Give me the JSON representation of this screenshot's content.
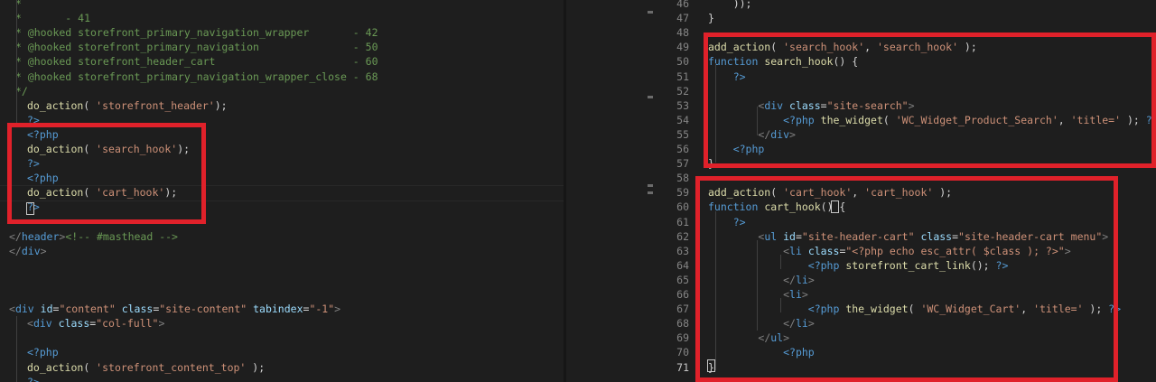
{
  "left_editor": {
    "lines": [
      [
        {
          "t": " *",
          "c": "c-comment"
        }
      ],
      [
        {
          "t": " *       - 41",
          "c": "c-comment"
        }
      ],
      [
        {
          "t": " * @hooked storefront_primary_navigation_wrapper       - 42",
          "c": "c-comment"
        }
      ],
      [
        {
          "t": " * @hooked storefront_primary_navigation               - 50",
          "c": "c-comment"
        }
      ],
      [
        {
          "t": " * @hooked storefront_header_cart                      - 60",
          "c": "c-comment"
        }
      ],
      [
        {
          "t": " * @hooked storefront_primary_navigation_wrapper_close - 68",
          "c": "c-comment"
        }
      ],
      [
        {
          "t": " */",
          "c": "c-comment"
        }
      ],
      [
        {
          "t": "do_action",
          "c": "c-func"
        },
        {
          "t": "( ",
          "c": "c-plain"
        },
        {
          "t": "'storefront_header'",
          "c": "c-string"
        },
        {
          "t": ");",
          "c": "c-plain"
        }
      ],
      [
        {
          "t": "?>",
          "c": "c-php"
        }
      ],
      [
        {
          "t": "<?php",
          "c": "c-php"
        }
      ],
      [
        {
          "t": "do_action",
          "c": "c-func"
        },
        {
          "t": "( ",
          "c": "c-plain"
        },
        {
          "t": "'search_hook'",
          "c": "c-string"
        },
        {
          "t": ");",
          "c": "c-plain"
        }
      ],
      [
        {
          "t": "?>",
          "c": "c-php"
        }
      ],
      [
        {
          "t": "<?php",
          "c": "c-php"
        }
      ],
      [
        {
          "t": "do_action",
          "c": "c-func"
        },
        {
          "t": "( ",
          "c": "c-plain"
        },
        {
          "t": "'cart_hook'",
          "c": "c-string"
        },
        {
          "t": ");",
          "c": "c-plain"
        }
      ],
      [
        {
          "t": "?>",
          "c": "c-php"
        }
      ],
      [],
      [
        {
          "t": "</",
          "c": "c-punct"
        },
        {
          "t": "header",
          "c": "c-tag"
        },
        {
          "t": ">",
          "c": "c-punct"
        },
        {
          "t": "<!-- #masthead -->",
          "c": "c-comment"
        }
      ],
      [
        {
          "t": "</",
          "c": "c-punct"
        },
        {
          "t": "div",
          "c": "c-tag"
        },
        {
          "t": ">",
          "c": "c-punct"
        }
      ],
      [],
      [],
      [],
      [
        {
          "t": "<",
          "c": "c-punct"
        },
        {
          "t": "div ",
          "c": "c-tag"
        },
        {
          "t": "id",
          "c": "c-attr"
        },
        {
          "t": "=",
          "c": "c-plain"
        },
        {
          "t": "\"content\" ",
          "c": "c-string"
        },
        {
          "t": "class",
          "c": "c-attr"
        },
        {
          "t": "=",
          "c": "c-plain"
        },
        {
          "t": "\"site-content\" ",
          "c": "c-string"
        },
        {
          "t": "tabindex",
          "c": "c-attr"
        },
        {
          "t": "=",
          "c": "c-plain"
        },
        {
          "t": "\"-1\"",
          "c": "c-string"
        },
        {
          "t": ">",
          "c": "c-punct"
        }
      ],
      [
        {
          "t": "<",
          "c": "c-punct"
        },
        {
          "t": "div ",
          "c": "c-tag"
        },
        {
          "t": "class",
          "c": "c-attr"
        },
        {
          "t": "=",
          "c": "c-plain"
        },
        {
          "t": "\"col-full\"",
          "c": "c-string"
        },
        {
          "t": ">",
          "c": "c-punct"
        }
      ],
      [],
      [
        {
          "t": "<?php",
          "c": "c-php"
        }
      ],
      [
        {
          "t": "do_action",
          "c": "c-func"
        },
        {
          "t": "( ",
          "c": "c-plain"
        },
        {
          "t": "'storefront_content_top'",
          "c": "c-string"
        },
        {
          "t": " );",
          "c": "c-plain"
        }
      ],
      [
        {
          "t": "?>",
          "c": "c-php"
        }
      ]
    ]
  },
  "right_editor": {
    "active_line": "71",
    "lines": [
      {
        "n": "46",
        "toks": [
          {
            "t": "    ));",
            "c": "c-plain"
          }
        ]
      },
      {
        "n": "47",
        "toks": [
          {
            "t": "}",
            "c": "c-plain"
          }
        ]
      },
      {
        "n": "48",
        "toks": []
      },
      {
        "n": "49",
        "toks": [
          {
            "t": "add_action",
            "c": "c-func"
          },
          {
            "t": "( ",
            "c": "c-plain"
          },
          {
            "t": "'search_hook'",
            "c": "c-string"
          },
          {
            "t": ", ",
            "c": "c-plain"
          },
          {
            "t": "'search_hook'",
            "c": "c-string"
          },
          {
            "t": " );",
            "c": "c-plain"
          }
        ]
      },
      {
        "n": "50",
        "toks": [
          {
            "t": "function ",
            "c": "c-keyword"
          },
          {
            "t": "search_hook",
            "c": "c-func"
          },
          {
            "t": "() {",
            "c": "c-plain"
          }
        ]
      },
      {
        "n": "51",
        "toks": [
          {
            "t": "    ",
            "c": "c-plain"
          },
          {
            "t": "?>",
            "c": "c-php"
          }
        ]
      },
      {
        "n": "52",
        "toks": []
      },
      {
        "n": "53",
        "toks": [
          {
            "t": "        ",
            "c": "c-plain"
          },
          {
            "t": "<",
            "c": "c-punct"
          },
          {
            "t": "div ",
            "c": "c-tag"
          },
          {
            "t": "class",
            "c": "c-attr"
          },
          {
            "t": "=",
            "c": "c-plain"
          },
          {
            "t": "\"site-search\"",
            "c": "c-string"
          },
          {
            "t": ">",
            "c": "c-punct"
          }
        ]
      },
      {
        "n": "54",
        "toks": [
          {
            "t": "            ",
            "c": "c-plain"
          },
          {
            "t": "<?php ",
            "c": "c-php"
          },
          {
            "t": "the_widget",
            "c": "c-func"
          },
          {
            "t": "( ",
            "c": "c-plain"
          },
          {
            "t": "'WC_Widget_Product_Search'",
            "c": "c-string"
          },
          {
            "t": ", ",
            "c": "c-plain"
          },
          {
            "t": "'title='",
            "c": "c-string"
          },
          {
            "t": " ); ",
            "c": "c-plain"
          },
          {
            "t": "?>",
            "c": "c-php"
          }
        ]
      },
      {
        "n": "55",
        "toks": [
          {
            "t": "        ",
            "c": "c-plain"
          },
          {
            "t": "</",
            "c": "c-punct"
          },
          {
            "t": "div",
            "c": "c-tag"
          },
          {
            "t": ">",
            "c": "c-punct"
          }
        ]
      },
      {
        "n": "56",
        "toks": [
          {
            "t": "    ",
            "c": "c-plain"
          },
          {
            "t": "<?php",
            "c": "c-php"
          }
        ]
      },
      {
        "n": "57",
        "toks": [
          {
            "t": "}",
            "c": "c-plain"
          }
        ]
      },
      {
        "n": "58",
        "toks": []
      },
      {
        "n": "59",
        "toks": [
          {
            "t": "add_action",
            "c": "c-func"
          },
          {
            "t": "( ",
            "c": "c-plain"
          },
          {
            "t": "'cart_hook'",
            "c": "c-string"
          },
          {
            "t": ", ",
            "c": "c-plain"
          },
          {
            "t": "'cart_hook'",
            "c": "c-string"
          },
          {
            "t": " );",
            "c": "c-plain"
          }
        ]
      },
      {
        "n": "60",
        "toks": [
          {
            "t": "function ",
            "c": "c-keyword"
          },
          {
            "t": "cart_hook",
            "c": "c-func"
          },
          {
            "t": "() {",
            "c": "c-plain"
          }
        ]
      },
      {
        "n": "61",
        "toks": [
          {
            "t": "    ",
            "c": "c-plain"
          },
          {
            "t": "?>",
            "c": "c-php"
          }
        ]
      },
      {
        "n": "62",
        "toks": [
          {
            "t": "        ",
            "c": "c-plain"
          },
          {
            "t": "<",
            "c": "c-punct"
          },
          {
            "t": "ul ",
            "c": "c-tag"
          },
          {
            "t": "id",
            "c": "c-attr"
          },
          {
            "t": "=",
            "c": "c-plain"
          },
          {
            "t": "\"site-header-cart\" ",
            "c": "c-string"
          },
          {
            "t": "class",
            "c": "c-attr"
          },
          {
            "t": "=",
            "c": "c-plain"
          },
          {
            "t": "\"site-header-cart menu\"",
            "c": "c-string"
          },
          {
            "t": ">",
            "c": "c-punct"
          }
        ]
      },
      {
        "n": "63",
        "toks": [
          {
            "t": "            ",
            "c": "c-plain"
          },
          {
            "t": "<",
            "c": "c-punct"
          },
          {
            "t": "li ",
            "c": "c-tag"
          },
          {
            "t": "class",
            "c": "c-attr"
          },
          {
            "t": "=",
            "c": "c-plain"
          },
          {
            "t": "\"<?php echo esc_attr( $class ); ?>\"",
            "c": "c-string"
          },
          {
            "t": ">",
            "c": "c-punct"
          }
        ]
      },
      {
        "n": "64",
        "toks": [
          {
            "t": "                ",
            "c": "c-plain"
          },
          {
            "t": "<?php ",
            "c": "c-php"
          },
          {
            "t": "storefront_cart_link",
            "c": "c-func"
          },
          {
            "t": "(); ",
            "c": "c-plain"
          },
          {
            "t": "?>",
            "c": "c-php"
          }
        ]
      },
      {
        "n": "65",
        "toks": [
          {
            "t": "            ",
            "c": "c-plain"
          },
          {
            "t": "</",
            "c": "c-punct"
          },
          {
            "t": "li",
            "c": "c-tag"
          },
          {
            "t": ">",
            "c": "c-punct"
          }
        ]
      },
      {
        "n": "66",
        "toks": [
          {
            "t": "            ",
            "c": "c-plain"
          },
          {
            "t": "<",
            "c": "c-punct"
          },
          {
            "t": "li",
            "c": "c-tag"
          },
          {
            "t": ">",
            "c": "c-punct"
          }
        ]
      },
      {
        "n": "67",
        "toks": [
          {
            "t": "                ",
            "c": "c-plain"
          },
          {
            "t": "<?php ",
            "c": "c-php"
          },
          {
            "t": "the_widget",
            "c": "c-func"
          },
          {
            "t": "( ",
            "c": "c-plain"
          },
          {
            "t": "'WC_Widget_Cart'",
            "c": "c-string"
          },
          {
            "t": ", ",
            "c": "c-plain"
          },
          {
            "t": "'title='",
            "c": "c-string"
          },
          {
            "t": " ); ",
            "c": "c-plain"
          },
          {
            "t": "?>",
            "c": "c-php"
          }
        ]
      },
      {
        "n": "68",
        "toks": [
          {
            "t": "            ",
            "c": "c-plain"
          },
          {
            "t": "</",
            "c": "c-punct"
          },
          {
            "t": "li",
            "c": "c-tag"
          },
          {
            "t": ">",
            "c": "c-punct"
          }
        ]
      },
      {
        "n": "69",
        "toks": [
          {
            "t": "        ",
            "c": "c-plain"
          },
          {
            "t": "</",
            "c": "c-punct"
          },
          {
            "t": "ul",
            "c": "c-tag"
          },
          {
            "t": ">",
            "c": "c-punct"
          }
        ]
      },
      {
        "n": "70",
        "toks": [
          {
            "t": "            ",
            "c": "c-plain"
          },
          {
            "t": "<?php",
            "c": "c-php"
          }
        ]
      },
      {
        "n": "71",
        "toks": [
          {
            "t": "}",
            "c": "c-plain"
          }
        ]
      }
    ]
  },
  "colors": {
    "background": "#1e1e1e",
    "annotation_red": "#e0212a"
  }
}
